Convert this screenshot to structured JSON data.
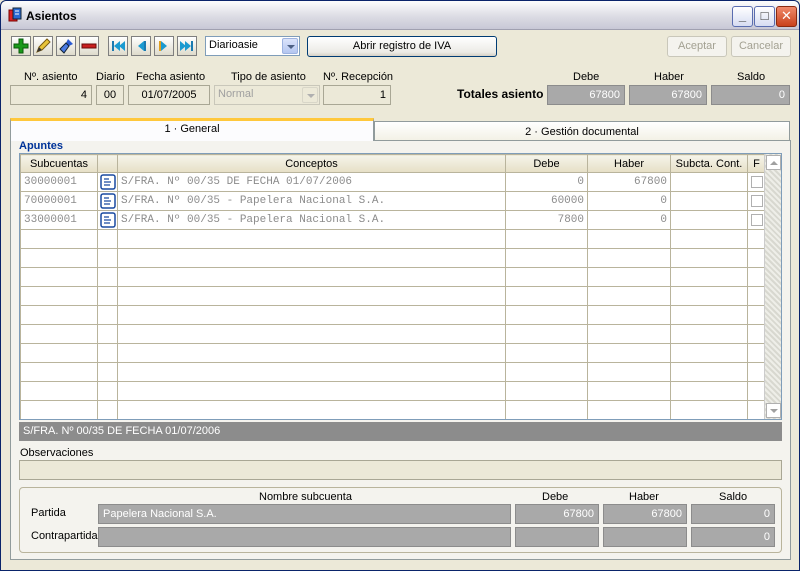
{
  "window": {
    "title": "Asientos"
  },
  "toolbar": {
    "diario_select": "Diarioasie",
    "iva_button": "Abrir registro de IVA",
    "aceptar_button": "Aceptar",
    "cancelar_button": "Cancelar"
  },
  "header": {
    "labels": {
      "num_asiento": "Nº. asiento",
      "diario": "Diario",
      "fecha": "Fecha asiento",
      "tipo": "Tipo de asiento",
      "recepcion": "Nº. Recepción",
      "debe": "Debe",
      "haber": "Haber",
      "saldo": "Saldo",
      "totales": "Totales asiento"
    },
    "num_asiento": "4",
    "diario": "00",
    "fecha": "01/07/2005",
    "tipo": "Normal",
    "recepcion": "1",
    "totales": {
      "debe": "67800",
      "haber": "67800",
      "saldo": "0"
    }
  },
  "tabs": [
    {
      "label": "1 · General",
      "active": true
    },
    {
      "label": "2 · Gestión documental",
      "active": false
    }
  ],
  "apuntes": {
    "label": "Apuntes",
    "columns": [
      "Subcuentas",
      "",
      "Conceptos",
      "Debe",
      "Haber",
      "Subcta. Cont.",
      "F"
    ],
    "rows": [
      {
        "subcuenta": "30000001",
        "concepto": "S/FRA. Nº 00/35 DE FECHA 01/07/2006",
        "debe": "0",
        "haber": "67800",
        "subcta_cont": ""
      },
      {
        "subcuenta": "70000001",
        "concepto": "S/FRA. Nº 00/35 - Papelera Nacional S.A.",
        "debe": "60000",
        "haber": "0",
        "subcta_cont": ""
      },
      {
        "subcuenta": "33000001",
        "concepto": "S/FRA. Nº 00/35 - Papelera Nacional S.A.",
        "debe": "7800",
        "haber": "0",
        "subcta_cont": ""
      }
    ],
    "empty_rows": 10
  },
  "status_line": "S/FRA. Nº 00/35 DE FECHA 01/07/2006",
  "observaciones": {
    "label": "Observaciones",
    "value": ""
  },
  "subcuenta_box": {
    "labels": {
      "nombre": "Nombre subcuenta",
      "debe": "Debe",
      "haber": "Haber",
      "saldo": "Saldo"
    },
    "partida": {
      "label": "Partida",
      "nombre": "Papelera Nacional S.A.",
      "debe": "67800",
      "haber": "67800",
      "saldo": "0"
    },
    "contrapartida": {
      "label": "Contrapartida",
      "nombre": "",
      "debe": "",
      "haber": "",
      "saldo": "0"
    }
  },
  "colors": {
    "accent_tab": "#ffc83c",
    "dark_field": "#a9a9a9",
    "status_bar": "#8c8c8c"
  }
}
